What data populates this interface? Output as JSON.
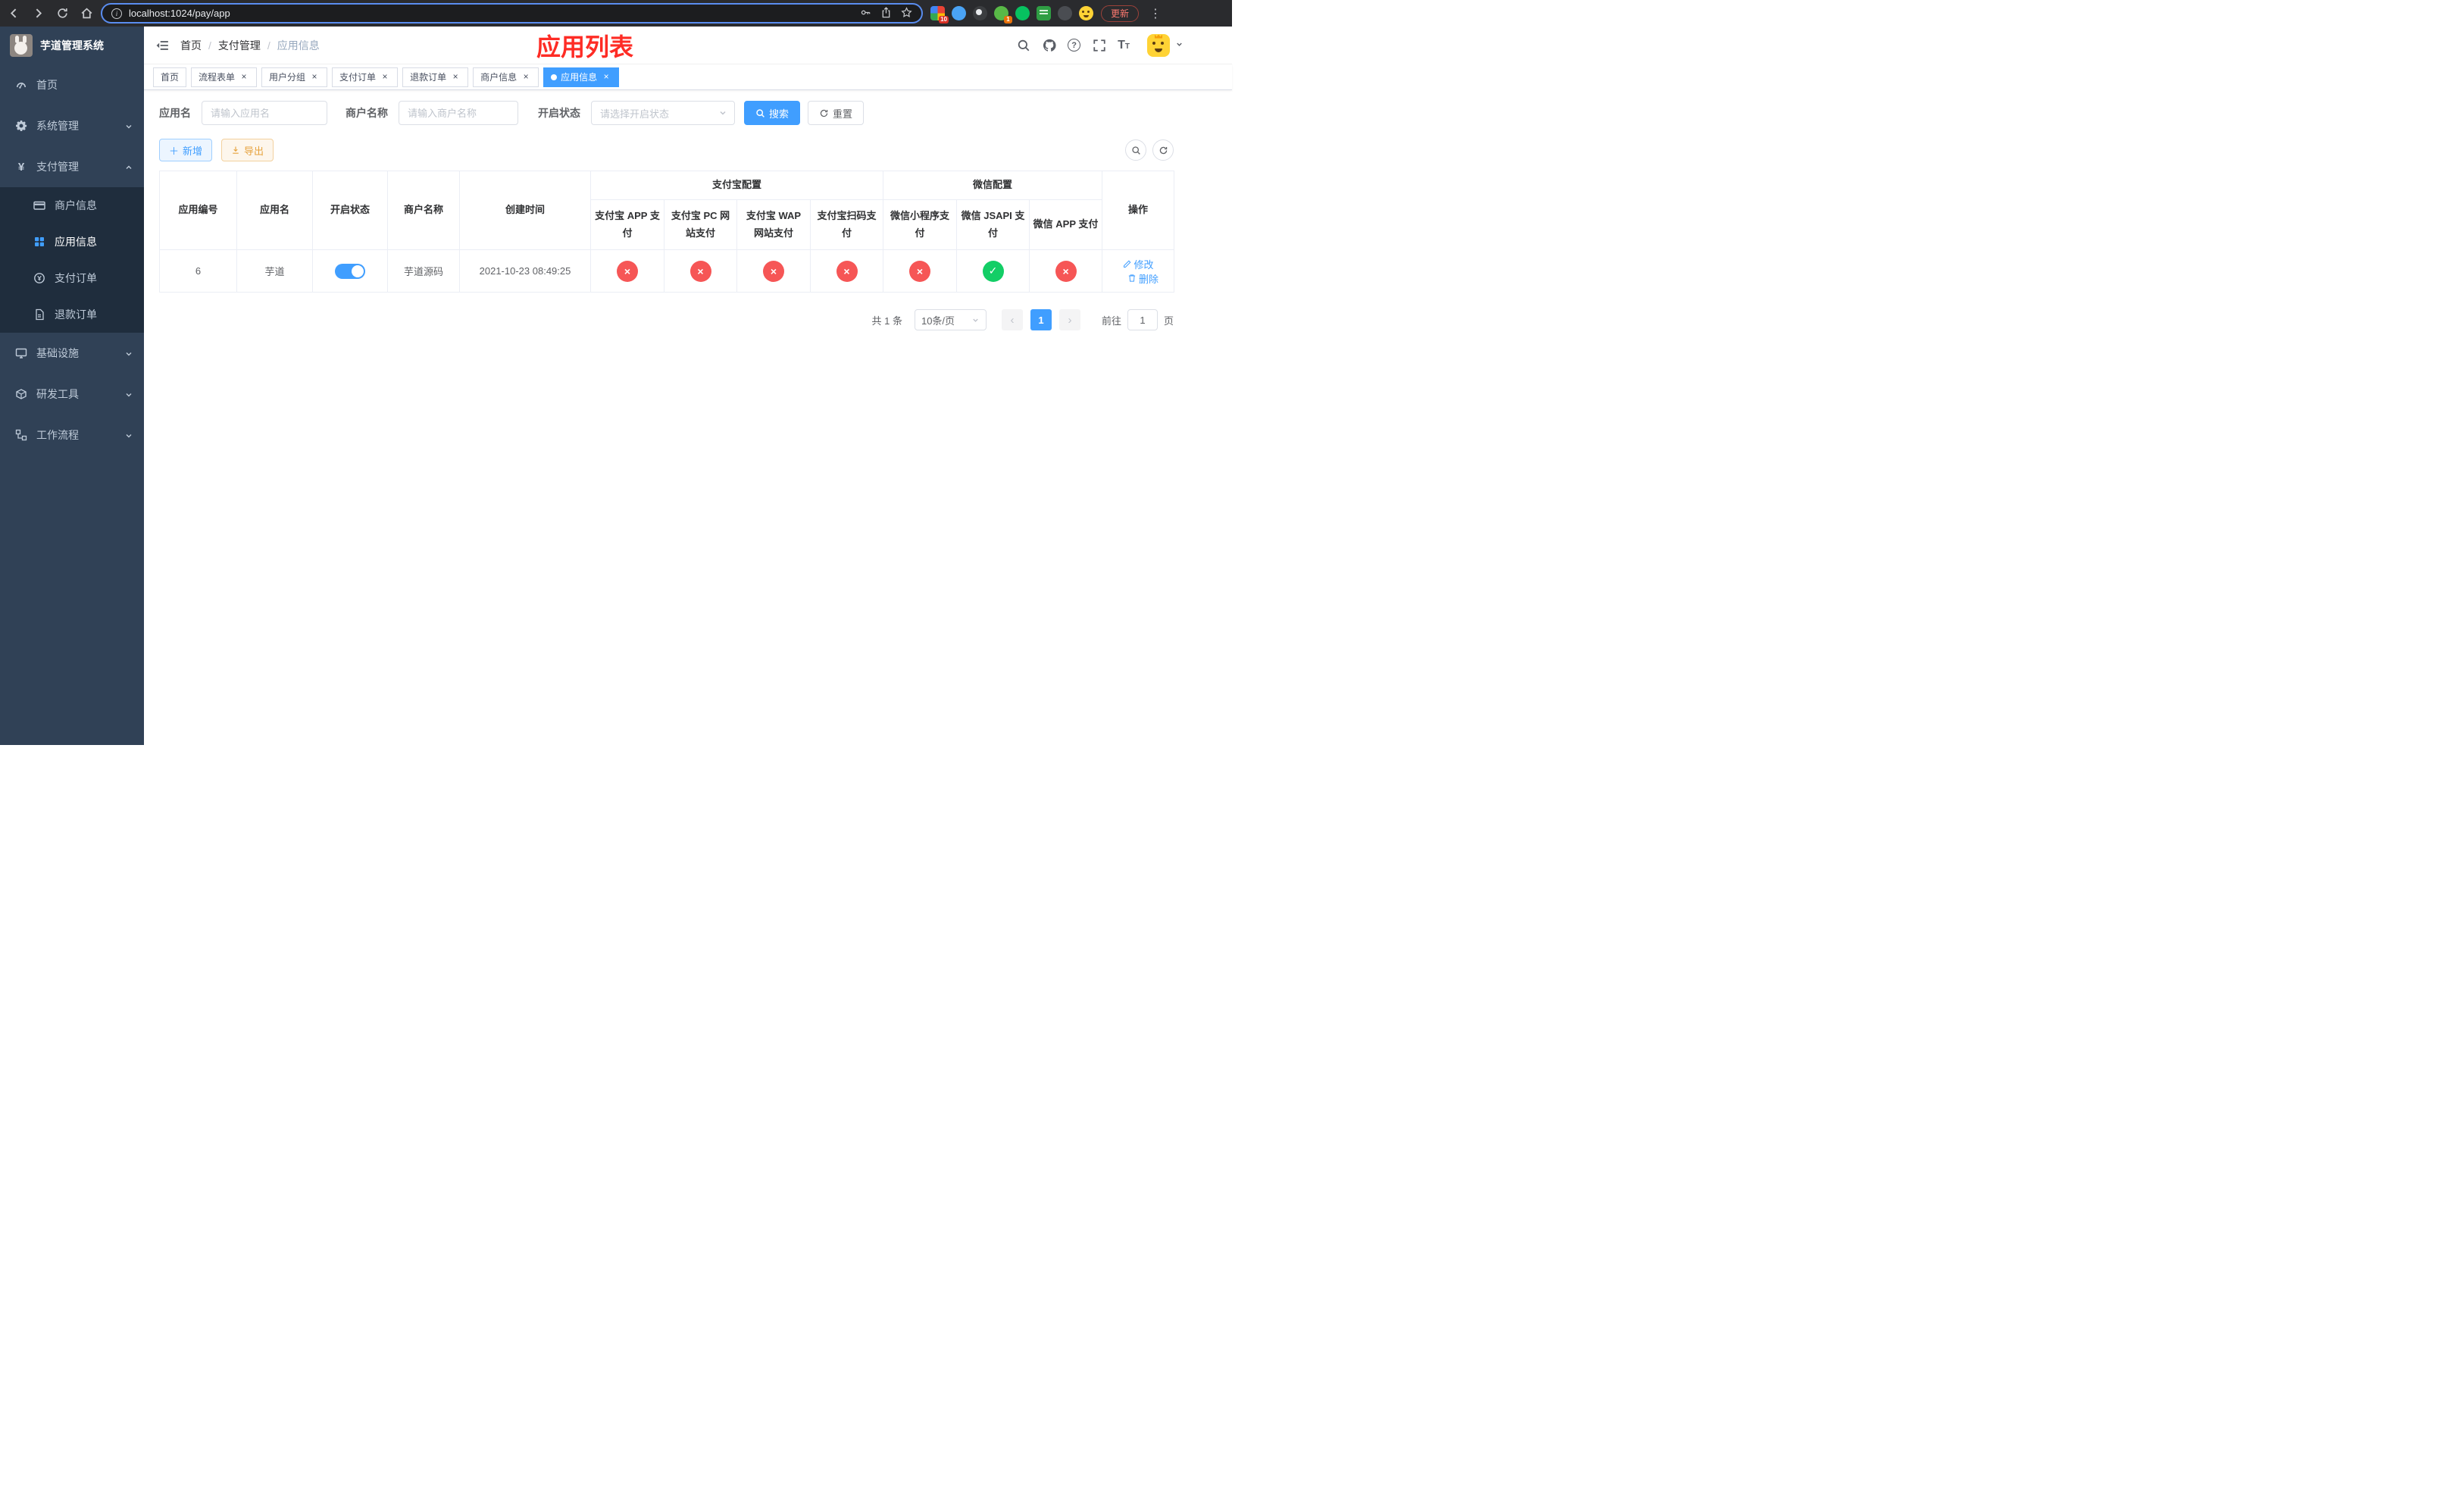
{
  "colors": {
    "primary": "#409eff",
    "danger_circle": "#f65656",
    "success_circle": "#13ce66",
    "warning": "#e6a23c",
    "sidebar_bg": "#304156",
    "submenu_bg": "#1f2d3d",
    "title_red": "#fe2c25"
  },
  "browser": {
    "url": "localhost:1024/pay/app",
    "update_button": "更新",
    "extension_badges": {
      "grid": "10",
      "profile": "1"
    },
    "icons": [
      "back-icon",
      "forward-icon",
      "reload-icon",
      "home-icon",
      "site-info-icon",
      "key-icon",
      "share-icon",
      "bookmark-star-icon",
      "kebab-menu-icon"
    ]
  },
  "sidebar": {
    "logo_title": "芋道管理系统",
    "items": [
      {
        "label": "首页",
        "icon": "dashboard-icon"
      },
      {
        "label": "系统管理",
        "icon": "gear-icon",
        "arrow": "down"
      },
      {
        "label": "支付管理",
        "icon": "yen-icon",
        "arrow": "up",
        "expanded": true
      },
      {
        "label": "商户信息",
        "icon": "card-icon",
        "sub": true
      },
      {
        "label": "应用信息",
        "icon": "grid-icon",
        "sub": true,
        "active": true
      },
      {
        "label": "支付订单",
        "icon": "order-icon",
        "sub": true
      },
      {
        "label": "退款订单",
        "icon": "refund-icon",
        "sub": true
      },
      {
        "label": "基础设施",
        "icon": "monitor-icon",
        "arrow": "down"
      },
      {
        "label": "研发工具",
        "icon": "tool-icon",
        "arrow": "down"
      },
      {
        "label": "工作流程",
        "icon": "flow-icon",
        "arrow": "down"
      }
    ]
  },
  "header": {
    "breadcrumb": {
      "home": "首页",
      "section": "支付管理",
      "current": "应用信息"
    },
    "title": "应用列表",
    "icons": [
      "search-icon",
      "github-icon",
      "question-icon",
      "fullscreen-icon",
      "font-size-icon",
      "avatar",
      "chevron-down-icon"
    ]
  },
  "tabs": [
    {
      "label": "首页",
      "closable": false,
      "active": false
    },
    {
      "label": "流程表单",
      "closable": true,
      "active": false
    },
    {
      "label": "用户分组",
      "closable": true,
      "active": false
    },
    {
      "label": "支付订单",
      "closable": true,
      "active": false
    },
    {
      "label": "退款订单",
      "closable": true,
      "active": false
    },
    {
      "label": "商户信息",
      "closable": true,
      "active": false
    },
    {
      "label": "应用信息",
      "closable": true,
      "active": true
    }
  ],
  "filters": {
    "app_name_label": "应用名",
    "app_name_placeholder": "请输入应用名",
    "merchant_label": "商户名称",
    "merchant_placeholder": "请输入商户名称",
    "status_label": "开启状态",
    "status_placeholder": "请选择开启状态",
    "search_button": "搜索",
    "reset_button": "重置"
  },
  "toolbar": {
    "add_button": "新增",
    "export_button": "导出"
  },
  "table": {
    "group_alipay": "支付宝配置",
    "group_wechat": "微信配置",
    "headers": {
      "id": "应用编号",
      "name": "应用名",
      "status": "开启状态",
      "merchant": "商户名称",
      "created": "创建时间",
      "op": "操作"
    },
    "sub_headers": [
      "支付宝 APP 支付",
      "支付宝 PC 网站支付",
      "支付宝 WAP 网站支付",
      "支付宝扫码支付",
      "微信小程序支付",
      "微信 JSAPI 支付",
      "微信 APP 支付"
    ],
    "row": {
      "id": "6",
      "name": "芋道",
      "enabled": true,
      "merchant": "芋道源码",
      "created": "2021-10-23 08:49:25",
      "pay_status": [
        false,
        false,
        false,
        false,
        false,
        true,
        false
      ],
      "edit": "修改",
      "delete": "删除"
    }
  },
  "pagination": {
    "total": "共 1 条",
    "page_size": "10条/页",
    "current_page": "1",
    "goto_label": "前往",
    "goto_value": "1",
    "page_unit": "页"
  }
}
